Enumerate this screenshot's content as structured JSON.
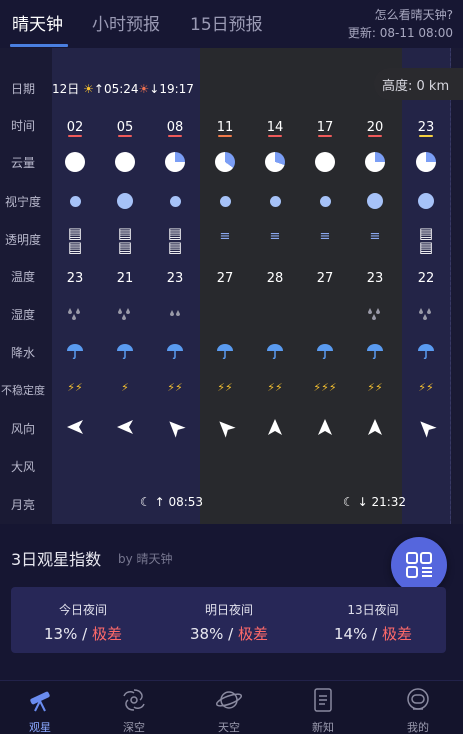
{
  "header": {
    "tabs": [
      {
        "label": "晴天钟",
        "active": true
      },
      {
        "label": "小时预报",
        "active": false
      },
      {
        "label": "15日预报",
        "active": false
      }
    ],
    "help_link": "怎么看晴天钟?",
    "updated": "更新:  08-11 08:00"
  },
  "grid": {
    "row_labels": [
      "日期",
      "时间",
      "云量",
      "视宁度",
      "透明度",
      "温度",
      "湿度",
      "降水",
      "不稳定度",
      "风向",
      "大风",
      "月亮"
    ],
    "date": "12日",
    "sunrise": "05:24",
    "sunset": "19:17",
    "altitude_label": "高度:  0 km",
    "hours": [
      "02",
      "05",
      "08",
      "11",
      "14",
      "17",
      "20",
      "23"
    ],
    "hour_bar_colors": [
      "#f05a5a",
      "#f05a5a",
      "#f05a5a",
      "#f07a4a",
      "#f05a5a",
      "#f05a5a",
      "#f05a5a",
      "#f5d040"
    ],
    "cloud_cover": [
      0,
      0,
      0.25,
      0.35,
      0.3,
      0,
      0.25,
      0.25
    ],
    "seeing": [
      "small",
      "large",
      "small",
      "small",
      "small",
      "small",
      "large",
      "large"
    ],
    "transparency": [
      "high",
      "high",
      "high",
      "low",
      "low",
      "low",
      "low",
      "high"
    ],
    "temperatures": [
      "23",
      "21",
      "23",
      "27",
      "28",
      "27",
      "23",
      "22"
    ],
    "humidity": [
      "high",
      "high",
      "low",
      "none",
      "none",
      "none",
      "high",
      "high"
    ],
    "rain_icon": "umbrella-icon",
    "instability": [
      "⚡⚡",
      "⚡",
      "⚡⚡",
      "⚡⚡",
      "⚡⚡",
      "⚡⚡⚡",
      "⚡⚡",
      "⚡⚡"
    ],
    "wind_direction_deg": [
      -90,
      -90,
      -45,
      -45,
      0,
      0,
      0,
      -45
    ],
    "moonrise": "08:53",
    "moonset": "21:32"
  },
  "index": {
    "title": "3日观星指数",
    "by": "by 晴天钟",
    "days": [
      {
        "label": "今日夜间",
        "percent": "13%",
        "rating": "极差"
      },
      {
        "label": "明日夜间",
        "percent": "38%",
        "rating": "极差"
      },
      {
        "label": "13日夜间",
        "percent": "14%",
        "rating": "极差"
      }
    ],
    "separator": "/"
  },
  "bottom_nav": [
    {
      "label": "观星",
      "icon": "telescope-icon",
      "active": true
    },
    {
      "label": "深空",
      "icon": "galaxy-icon",
      "active": false
    },
    {
      "label": "天空",
      "icon": "planet-icon",
      "active": false
    },
    {
      "label": "新知",
      "icon": "document-icon",
      "active": false
    },
    {
      "label": "我的",
      "icon": "astronaut-icon",
      "active": false
    }
  ],
  "colors": {
    "background": "#161632",
    "accent": "#4a7fe0",
    "bad_rating": "#ff6a6a",
    "bolt": "#f5c030",
    "rain": "#5a9bf0",
    "nav_active": "#8aa8ff"
  }
}
